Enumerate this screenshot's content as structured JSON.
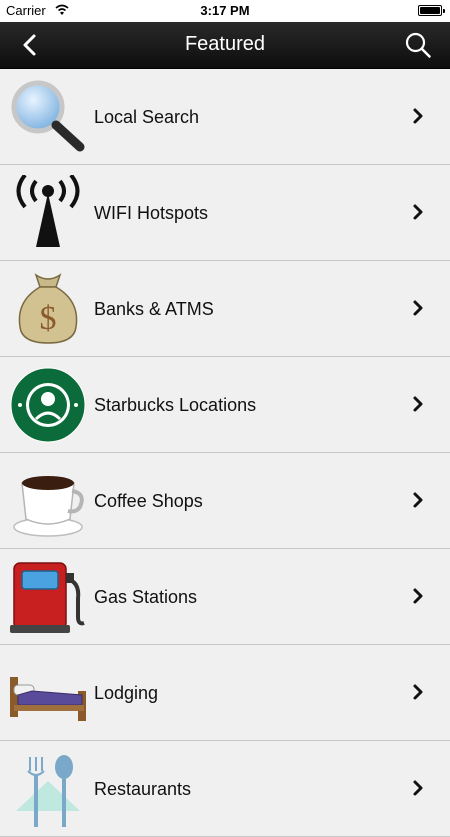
{
  "status_bar": {
    "carrier": "Carrier",
    "time": "3:17 PM"
  },
  "nav": {
    "title": "Featured",
    "back_icon": "chevron-left-icon",
    "search_icon": "search-icon"
  },
  "items": [
    {
      "label": "Local Search",
      "icon": "magnifier-icon"
    },
    {
      "label": "WIFI Hotspots",
      "icon": "antenna-icon"
    },
    {
      "label": "Banks & ATMS",
      "icon": "money-bag-icon"
    },
    {
      "label": "Starbucks Locations",
      "icon": "starbucks-logo-icon"
    },
    {
      "label": "Coffee Shops",
      "icon": "coffee-cup-icon"
    },
    {
      "label": "Gas Stations",
      "icon": "gas-pump-icon"
    },
    {
      "label": "Lodging",
      "icon": "bed-icon"
    },
    {
      "label": "Restaurants",
      "icon": "utensils-icon"
    }
  ]
}
